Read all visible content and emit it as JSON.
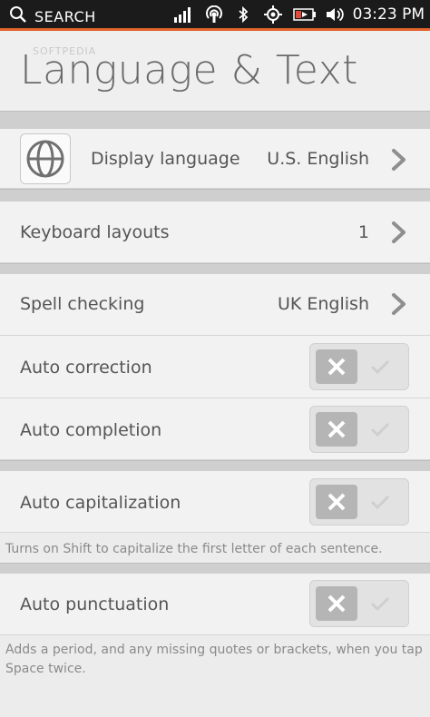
{
  "status_bar": {
    "search_label": "SEARCH",
    "time": "03:23 PM",
    "indicators": [
      "signal-icon",
      "hotspot-icon",
      "bluetooth-icon",
      "location-icon",
      "battery-icon",
      "volume-icon"
    ]
  },
  "header": {
    "title": "Language & Text",
    "watermark": "SOFTPEDIA"
  },
  "rows": {
    "display_language": {
      "label": "Display language",
      "value": "U.S. English"
    },
    "keyboard_layouts": {
      "label": "Keyboard layouts",
      "value": "1"
    },
    "spell_checking": {
      "label": "Spell checking",
      "value": "UK English"
    },
    "auto_correction": {
      "label": "Auto correction",
      "state": "off"
    },
    "auto_completion": {
      "label": "Auto completion",
      "state": "off"
    },
    "auto_capitalization": {
      "label": "Auto capitalization",
      "state": "off",
      "note": "Turns on Shift to capitalize the first letter of each sentence."
    },
    "auto_punctuation": {
      "label": "Auto punctuation",
      "state": "off",
      "note": "Adds a period, and any missing quotes or brackets, when you tap Space twice."
    }
  },
  "colors": {
    "accent": "#e1622b",
    "statusbar": "#1b1b1b",
    "background": "#ececec"
  }
}
